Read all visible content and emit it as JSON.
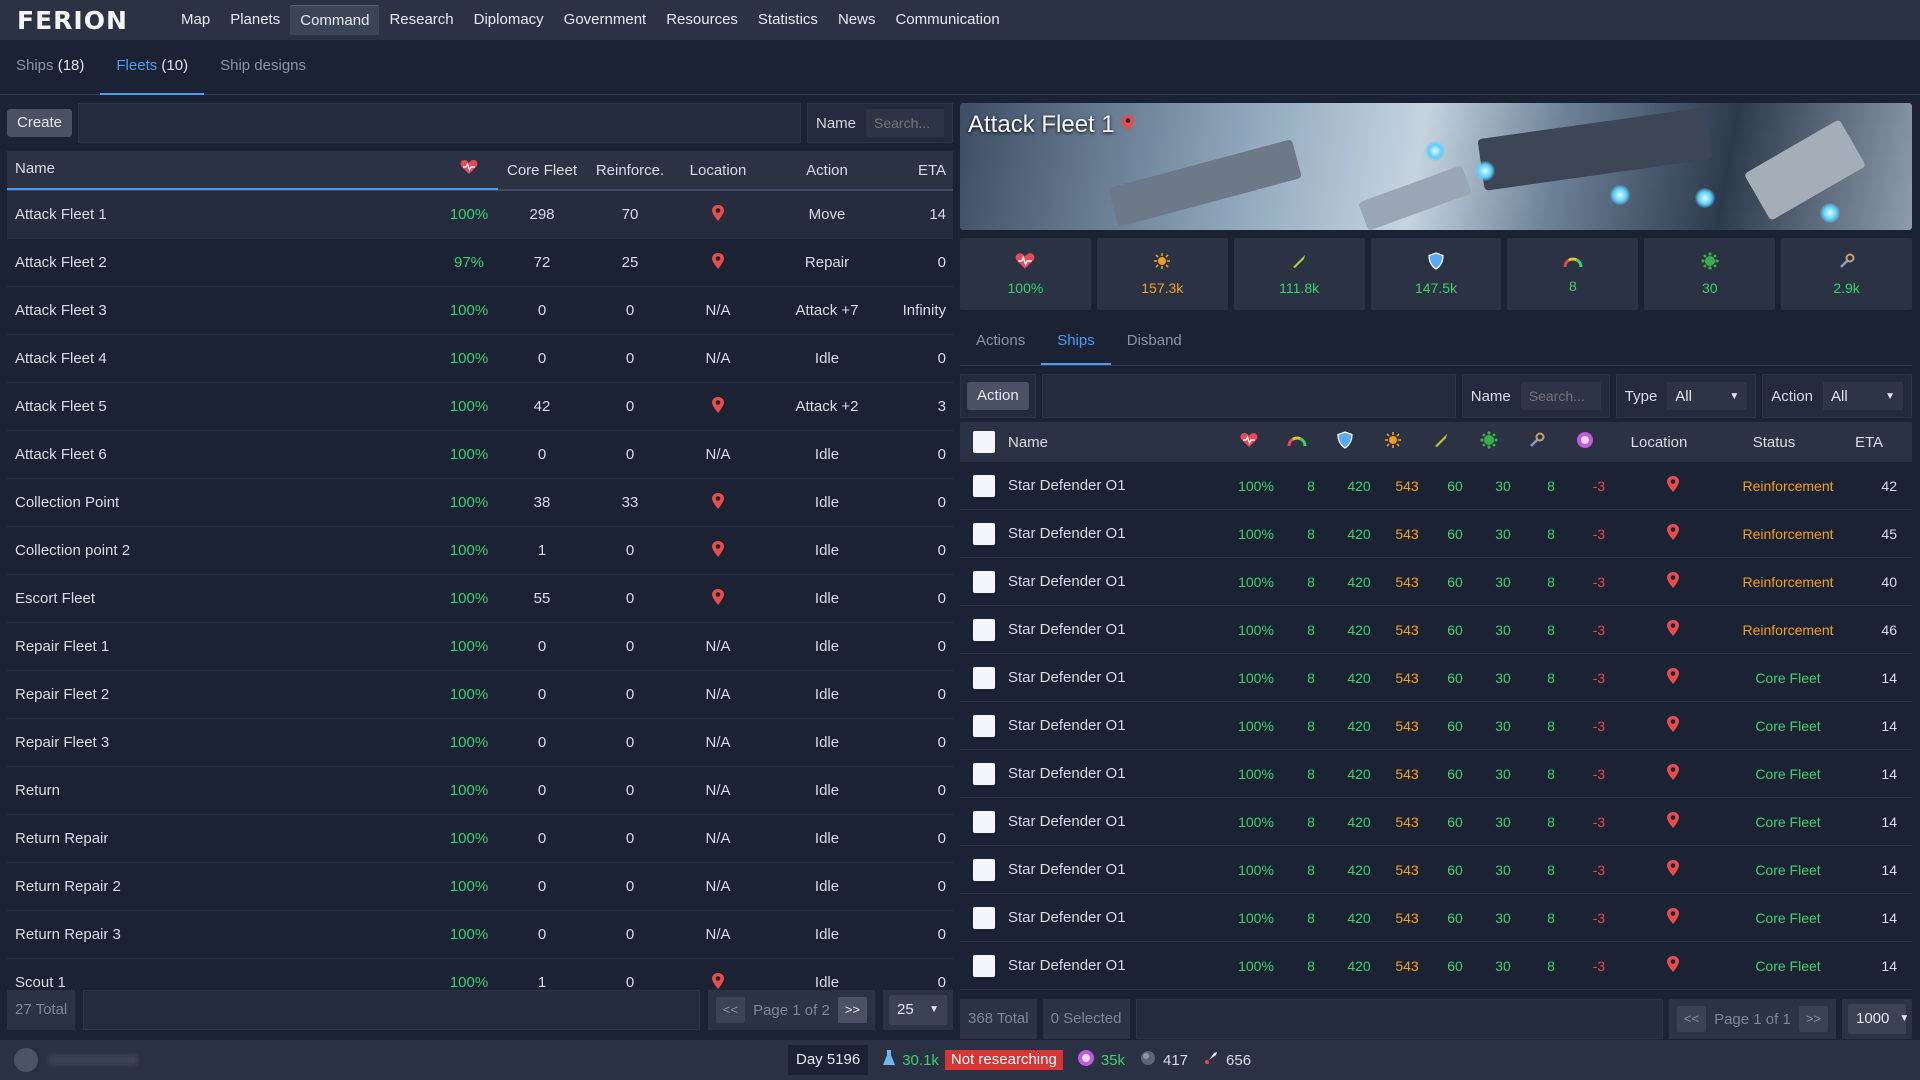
{
  "app": {
    "logo": "FERION",
    "nav": [
      "Map",
      "Planets",
      "Command",
      "Research",
      "Diplomacy",
      "Government",
      "Resources",
      "Statistics",
      "News",
      "Communication"
    ],
    "active_nav": "Command"
  },
  "subtabs": {
    "ships_label": "Ships",
    "ships_count": "(18)",
    "fleets_label": "Fleets",
    "fleets_count": "(10)",
    "designs_label": "Ship designs"
  },
  "fleets": {
    "create_label": "Create",
    "name_label": "Name",
    "search_placeholder": "Search...",
    "headers": {
      "name": "Name",
      "core": "Core Fleet",
      "reinforce": "Reinforce.",
      "location": "Location",
      "action": "Action",
      "eta": "ETA"
    },
    "rows": [
      {
        "name": "Attack Fleet 1",
        "health": "100%",
        "core": "298",
        "reinforce": "70",
        "location": "pin",
        "action": "Move",
        "eta": "14"
      },
      {
        "name": "Attack Fleet 2",
        "health": "97%",
        "core": "72",
        "reinforce": "25",
        "location": "pin",
        "action": "Repair",
        "eta": "0"
      },
      {
        "name": "Attack Fleet 3",
        "health": "100%",
        "core": "0",
        "reinforce": "0",
        "location": "N/A",
        "action": "Attack +7",
        "eta": "Infinity"
      },
      {
        "name": "Attack Fleet 4",
        "health": "100%",
        "core": "0",
        "reinforce": "0",
        "location": "N/A",
        "action": "Idle",
        "eta": "0"
      },
      {
        "name": "Attack Fleet 5",
        "health": "100%",
        "core": "42",
        "reinforce": "0",
        "location": "pin",
        "action": "Attack +2",
        "eta": "3"
      },
      {
        "name": "Attack Fleet 6",
        "health": "100%",
        "core": "0",
        "reinforce": "0",
        "location": "N/A",
        "action": "Idle",
        "eta": "0"
      },
      {
        "name": "Collection Point",
        "health": "100%",
        "core": "38",
        "reinforce": "33",
        "location": "pin",
        "action": "Idle",
        "eta": "0"
      },
      {
        "name": "Collection point 2",
        "health": "100%",
        "core": "1",
        "reinforce": "0",
        "location": "pin",
        "action": "Idle",
        "eta": "0"
      },
      {
        "name": "Escort Fleet",
        "health": "100%",
        "core": "55",
        "reinforce": "0",
        "location": "pin",
        "action": "Idle",
        "eta": "0"
      },
      {
        "name": "Repair Fleet 1",
        "health": "100%",
        "core": "0",
        "reinforce": "0",
        "location": "N/A",
        "action": "Idle",
        "eta": "0"
      },
      {
        "name": "Repair Fleet 2",
        "health": "100%",
        "core": "0",
        "reinforce": "0",
        "location": "N/A",
        "action": "Idle",
        "eta": "0"
      },
      {
        "name": "Repair Fleet 3",
        "health": "100%",
        "core": "0",
        "reinforce": "0",
        "location": "N/A",
        "action": "Idle",
        "eta": "0"
      },
      {
        "name": "Return",
        "health": "100%",
        "core": "0",
        "reinforce": "0",
        "location": "N/A",
        "action": "Idle",
        "eta": "0"
      },
      {
        "name": "Return Repair",
        "health": "100%",
        "core": "0",
        "reinforce": "0",
        "location": "N/A",
        "action": "Idle",
        "eta": "0"
      },
      {
        "name": "Return Repair 2",
        "health": "100%",
        "core": "0",
        "reinforce": "0",
        "location": "N/A",
        "action": "Idle",
        "eta": "0"
      },
      {
        "name": "Return Repair 3",
        "health": "100%",
        "core": "0",
        "reinforce": "0",
        "location": "N/A",
        "action": "Idle",
        "eta": "0"
      },
      {
        "name": "Scout 1",
        "health": "100%",
        "core": "1",
        "reinforce": "0",
        "location": "pin",
        "action": "Idle",
        "eta": "0"
      }
    ],
    "total": "27 Total",
    "page_text": "Page 1 of 2",
    "prev": "<<",
    "next": ">>",
    "page_size": "25"
  },
  "detail": {
    "title": "Attack Fleet 1",
    "stats": [
      {
        "icon": "heart-icon",
        "value": "100%",
        "color": "#3ad16a"
      },
      {
        "icon": "firepower-icon",
        "value": "157.3k",
        "color": "#f0a020"
      },
      {
        "icon": "missile-icon",
        "value": "111.8k",
        "color": "#3ad16a"
      },
      {
        "icon": "shield-icon",
        "value": "147.5k",
        "color": "#3ad16a"
      },
      {
        "icon": "speed-gauge-icon",
        "value": "8",
        "color": "#3ad16a"
      },
      {
        "icon": "virus-icon",
        "value": "30",
        "color": "#3ad16a"
      },
      {
        "icon": "wrench-icon",
        "value": "2.9k",
        "color": "#3ad16a"
      }
    ],
    "tabs": [
      "Actions",
      "Ships",
      "Disband"
    ],
    "active_tab": "Ships",
    "action_label": "Action",
    "name_label": "Name",
    "search_placeholder": "Search...",
    "type_label": "Type",
    "type_value": "All",
    "action_filter_label": "Action",
    "action_filter_value": "All",
    "headers": {
      "name": "Name",
      "location": "Location",
      "status": "Status",
      "eta": "ETA"
    },
    "ships": [
      {
        "name": "Star Defender O1",
        "hp": "100%",
        "speed": "8",
        "shield": "420",
        "fire": "543",
        "missile": "60",
        "bio": "30",
        "repair": "8",
        "upkeep": "-3",
        "status": "Reinforcement",
        "eta": "42"
      },
      {
        "name": "Star Defender O1",
        "hp": "100%",
        "speed": "8",
        "shield": "420",
        "fire": "543",
        "missile": "60",
        "bio": "30",
        "repair": "8",
        "upkeep": "-3",
        "status": "Reinforcement",
        "eta": "45"
      },
      {
        "name": "Star Defender O1",
        "hp": "100%",
        "speed": "8",
        "shield": "420",
        "fire": "543",
        "missile": "60",
        "bio": "30",
        "repair": "8",
        "upkeep": "-3",
        "status": "Reinforcement",
        "eta": "40"
      },
      {
        "name": "Star Defender O1",
        "hp": "100%",
        "speed": "8",
        "shield": "420",
        "fire": "543",
        "missile": "60",
        "bio": "30",
        "repair": "8",
        "upkeep": "-3",
        "status": "Reinforcement",
        "eta": "46"
      },
      {
        "name": "Star Defender O1",
        "hp": "100%",
        "speed": "8",
        "shield": "420",
        "fire": "543",
        "missile": "60",
        "bio": "30",
        "repair": "8",
        "upkeep": "-3",
        "status": "Core Fleet",
        "eta": "14"
      },
      {
        "name": "Star Defender O1",
        "hp": "100%",
        "speed": "8",
        "shield": "420",
        "fire": "543",
        "missile": "60",
        "bio": "30",
        "repair": "8",
        "upkeep": "-3",
        "status": "Core Fleet",
        "eta": "14"
      },
      {
        "name": "Star Defender O1",
        "hp": "100%",
        "speed": "8",
        "shield": "420",
        "fire": "543",
        "missile": "60",
        "bio": "30",
        "repair": "8",
        "upkeep": "-3",
        "status": "Core Fleet",
        "eta": "14"
      },
      {
        "name": "Star Defender O1",
        "hp": "100%",
        "speed": "8",
        "shield": "420",
        "fire": "543",
        "missile": "60",
        "bio": "30",
        "repair": "8",
        "upkeep": "-3",
        "status": "Core Fleet",
        "eta": "14"
      },
      {
        "name": "Star Defender O1",
        "hp": "100%",
        "speed": "8",
        "shield": "420",
        "fire": "543",
        "missile": "60",
        "bio": "30",
        "repair": "8",
        "upkeep": "-3",
        "status": "Core Fleet",
        "eta": "14"
      },
      {
        "name": "Star Defender O1",
        "hp": "100%",
        "speed": "8",
        "shield": "420",
        "fire": "543",
        "missile": "60",
        "bio": "30",
        "repair": "8",
        "upkeep": "-3",
        "status": "Core Fleet",
        "eta": "14"
      },
      {
        "name": "Star Defender O1",
        "hp": "100%",
        "speed": "8",
        "shield": "420",
        "fire": "543",
        "missile": "60",
        "bio": "30",
        "repair": "8",
        "upkeep": "-3",
        "status": "Core Fleet",
        "eta": "14"
      }
    ],
    "total": "368 Total",
    "selected": "0 Selected",
    "page_text": "Page 1 of 1",
    "prev": "<<",
    "next": ">>",
    "page_size": "1000"
  },
  "statusbar": {
    "day": "Day 5196",
    "research_points": "30.1k",
    "research_status": "Not researching",
    "energy": "35k",
    "planets": "417",
    "ships": "656"
  },
  "colors": {
    "accent": "#4a9cf0",
    "good": "#3ad16a",
    "warn": "#f0a020",
    "bad": "#e64848"
  }
}
